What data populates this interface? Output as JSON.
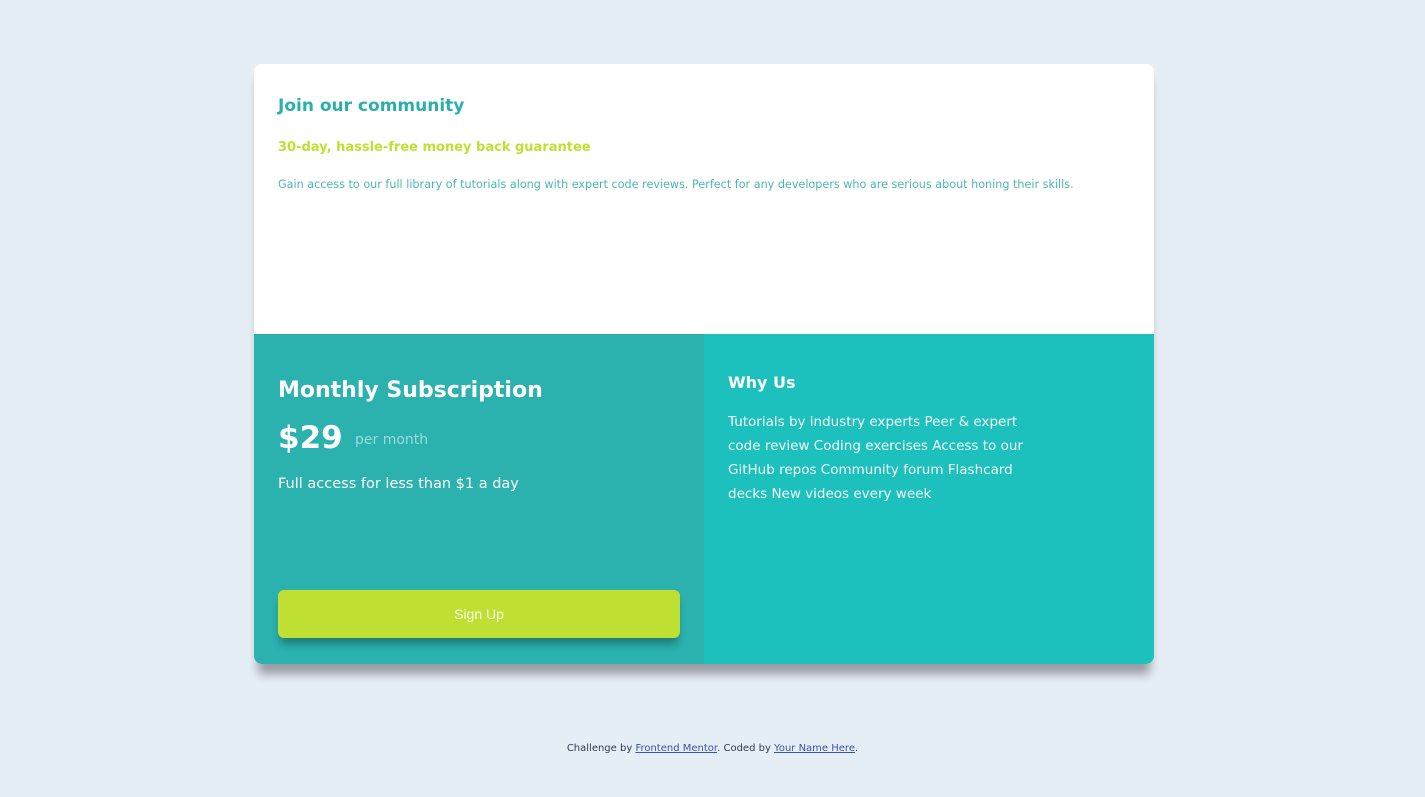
{
  "top": {
    "title": "Join our community",
    "subtitle": "30-day, hassle-free money back guarantee",
    "description": "Gain access to our full library of tutorials along with expert code reviews. Perfect for any developers who are serious about honing their skills."
  },
  "subscription": {
    "title": "Monthly Subscription",
    "price": "$29",
    "period": "per month",
    "tagline": "Full access for less than $1 a day",
    "button_label": "Sign Up"
  },
  "why_us": {
    "title": "Why Us",
    "text": "Tutorials by industry experts Peer & expert code review Coding exercises Access to our GitHub repos Community forum Flashcard decks New videos every week"
  },
  "attribution": {
    "prefix": "Challenge by ",
    "link1": "Frontend Mentor",
    "middle": ". Coded by ",
    "link2": "Your Name Here",
    "suffix": "."
  },
  "colors": {
    "background": "#e5edf5",
    "cyan_dark": "#2bb1ae",
    "cyan_light": "#1cc1bd",
    "lime": "#bfe032",
    "white": "#ffffff"
  }
}
